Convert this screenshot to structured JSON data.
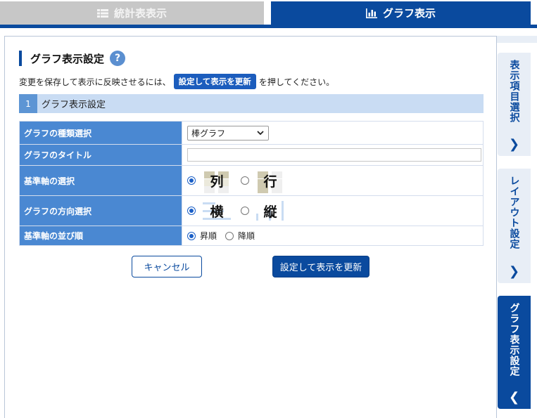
{
  "tabs": {
    "stats": {
      "label": "統計表表示",
      "icon": "table-icon"
    },
    "graph": {
      "label": "グラフ表示",
      "icon": "bar-chart-icon"
    }
  },
  "panel": {
    "title": "グラフ表示設定",
    "help": "?",
    "note_before": "変更を保存して表示に反映させるには、",
    "note_chip": "設定して表示を更新",
    "note_after": "を押してください。",
    "section_number": "1",
    "section_title": "グラフ表示設定",
    "rows": {
      "type": {
        "label": "グラフの種類選択",
        "value": "棒グラフ"
      },
      "title": {
        "label": "グラフのタイトル",
        "value": ""
      },
      "axis": {
        "label": "基準軸の選択",
        "options": [
          "列",
          "行"
        ],
        "selected": "列"
      },
      "direction": {
        "label": "グラフの方向選択",
        "options": [
          "横",
          "縦"
        ],
        "selected": "横"
      },
      "order": {
        "label": "基準軸の並び順",
        "options": [
          "昇順",
          "降順"
        ],
        "selected": "昇順"
      }
    },
    "buttons": {
      "cancel": "キャンセル",
      "update": "設定して表示を更新"
    }
  },
  "side_tabs": [
    {
      "label": "表示項目選択",
      "arrow": "❯"
    },
    {
      "label": "レイアウト設定",
      "arrow": "❯"
    },
    {
      "label": "グラフ表示設定",
      "arrow": "❮"
    }
  ],
  "colors": {
    "primary": "#0a4a9e",
    "header_cell": "#4a88d2",
    "section_bg": "#c9dcf3"
  }
}
